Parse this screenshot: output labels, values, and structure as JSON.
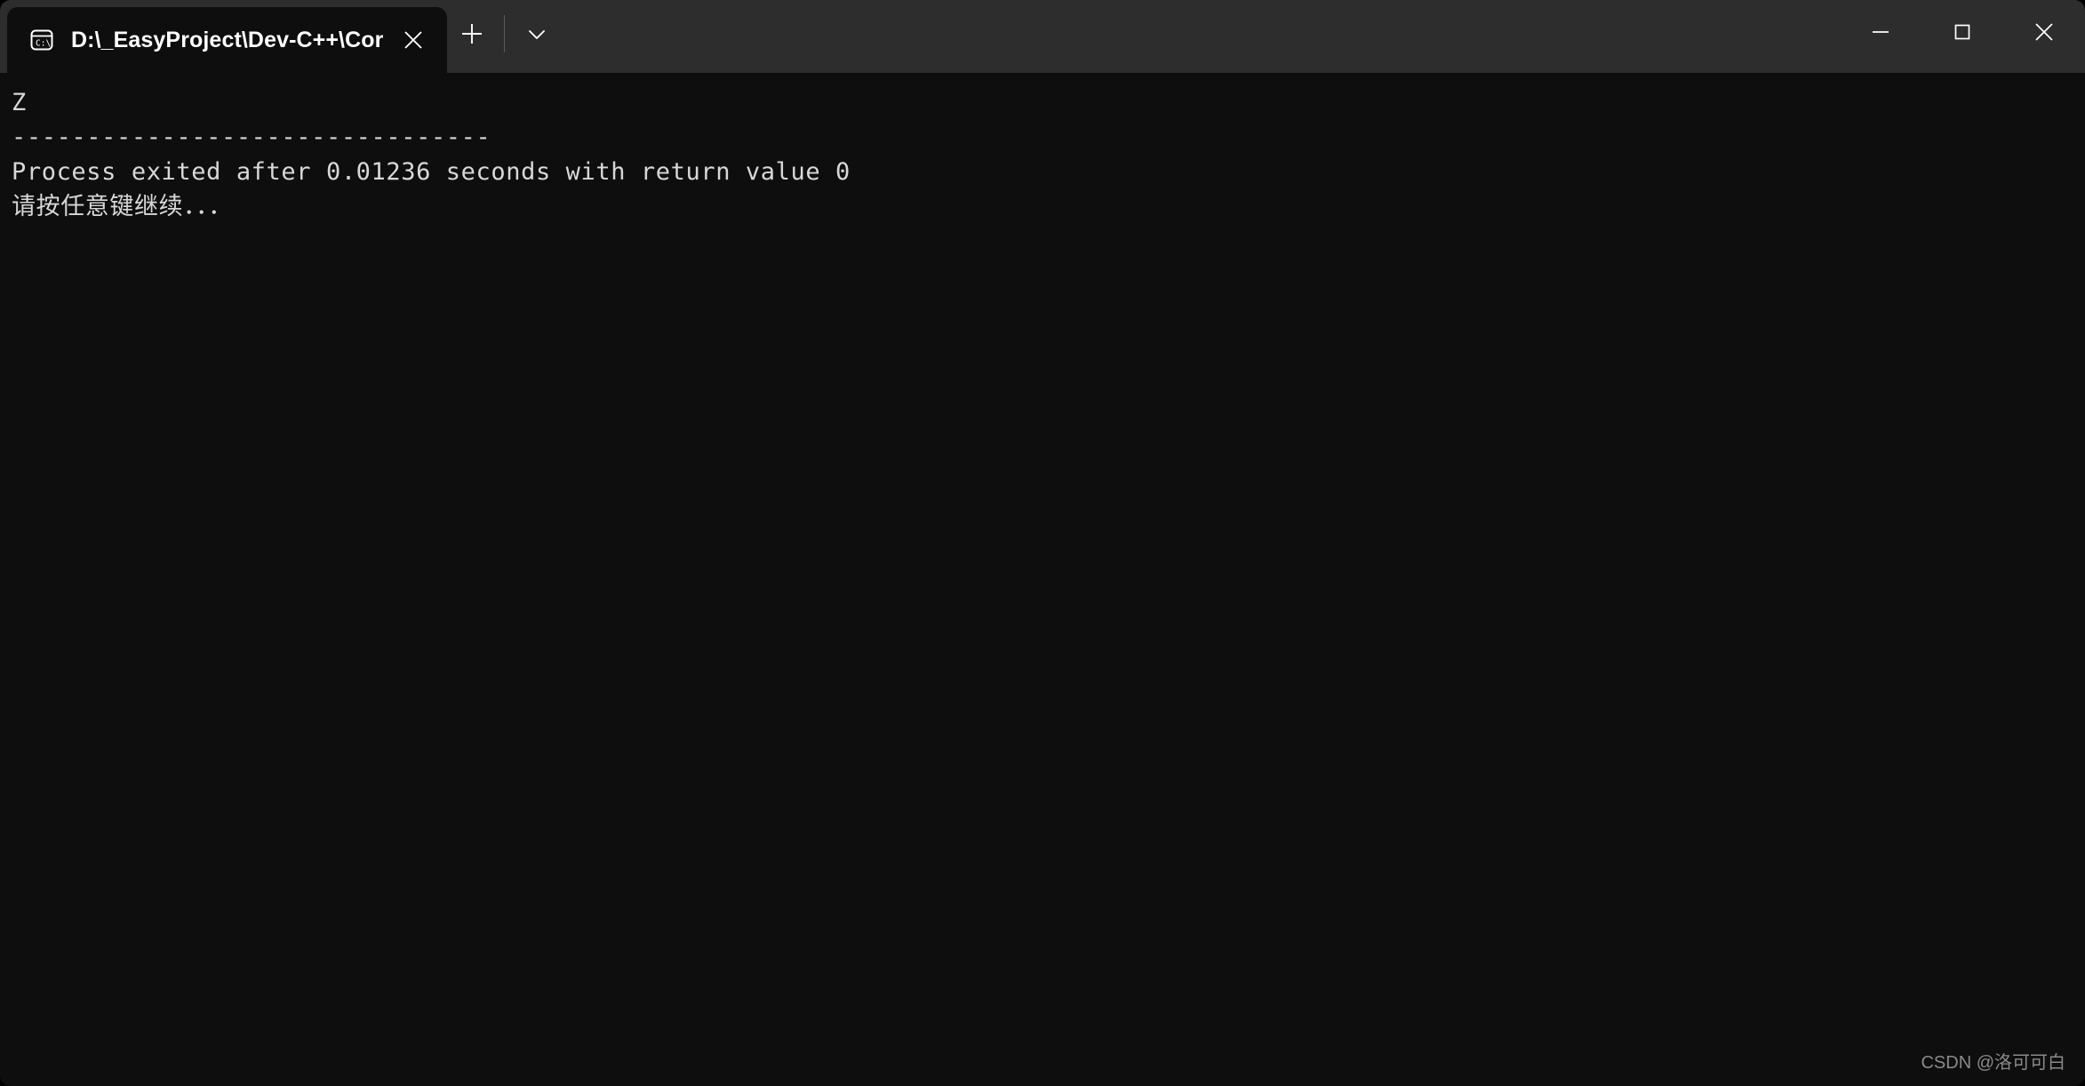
{
  "window": {
    "background_color": "#0e0e0e",
    "titlebar_color": "#2d2d2d"
  },
  "titlebar": {
    "tabs": [
      {
        "icon": "command-prompt-icon",
        "title": "D:\\_EasyProject\\Dev-C++\\Cor",
        "close_label": "✕",
        "active": true
      }
    ],
    "new_tab_label": "+",
    "dropdown_label": "⌄",
    "caption": {
      "minimize_label": "—",
      "maximize_label": "□",
      "close_label": "✕"
    }
  },
  "terminal": {
    "text_color": "#d8d8d8",
    "lines": [
      "Z",
      "",
      "",
      "--------------------------------",
      "Process exited after 0.01236 seconds with return value 0",
      "请按任意键继续．．．"
    ],
    "exit_info": {
      "duration_seconds": "0.01236",
      "return_value": "0"
    }
  },
  "watermark": {
    "text": "CSDN @洛可可白"
  }
}
